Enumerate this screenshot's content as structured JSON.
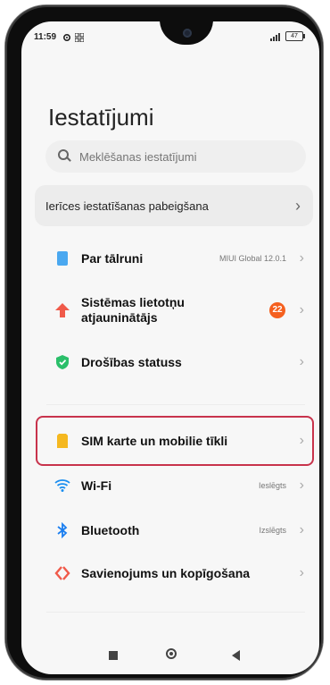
{
  "status": {
    "time": "11:59",
    "battery": "47",
    "signal": "4G"
  },
  "page": {
    "title": "Iestatījumi"
  },
  "search": {
    "placeholder": "Meklēšanas iestatījumi"
  },
  "banner": {
    "label": "Ierīces iestatīšanas pabeigšana"
  },
  "items": [
    {
      "label": "Par tālruni",
      "value": "MIUI Global 12.0.1",
      "icon": "phone-icon",
      "color": "#4aa8f0"
    },
    {
      "label": "Sistēmas lietotņu atjauninātājs",
      "badge": "22",
      "icon": "arrow-up-icon",
      "color": "#f05a4a"
    },
    {
      "label": "Drošības statuss",
      "icon": "shield-check-icon",
      "color": "#2bbf6a"
    },
    {
      "label": "SIM karte un mobilie tīkli",
      "icon": "sim-card-icon",
      "color": "#f5b820"
    },
    {
      "label": "Wi-Fi",
      "value": "Ieslēgts",
      "icon": "wifi-icon",
      "color": "#1a8ef0"
    },
    {
      "label": "Bluetooth",
      "value": "Izslēgts",
      "icon": "bluetooth-icon",
      "color": "#1a7ef0"
    },
    {
      "label": "Savienojums un kopīgošana",
      "icon": "share-connection-icon",
      "color": "#f05a4a"
    }
  ],
  "highlight_color": "#c8334c"
}
